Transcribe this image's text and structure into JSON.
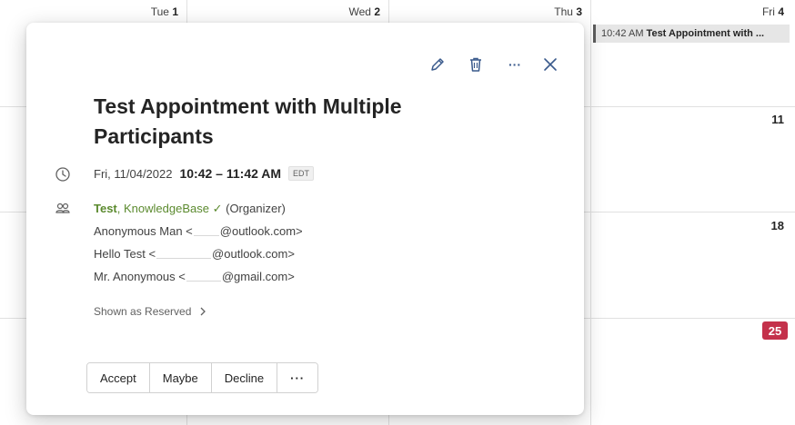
{
  "calendar": {
    "days": [
      {
        "weekday": "Tue",
        "day": "1"
      },
      {
        "weekday": "Wed",
        "day": "2"
      },
      {
        "weekday": "Thu",
        "day": "3"
      },
      {
        "weekday": "Fri",
        "day": "4"
      }
    ],
    "week_dates": [
      "11",
      "18"
    ],
    "today_date": "25",
    "event_chip": {
      "time": "10:42 AM",
      "title": "Test Appointment with ..."
    }
  },
  "popup": {
    "title": "Test Appointment with Multiple Participants",
    "date": "Fri, 11/04/2022",
    "time": "10:42 – 11:42 AM",
    "timezone": "EDT",
    "organizer": {
      "first": "Test",
      "rest": ", KnowledgeBase",
      "check": "✓",
      "role": "(Organizer)"
    },
    "participants": [
      {
        "name": "Anonymous Man <",
        "domain": "@outlook.com>"
      },
      {
        "name": "Hello Test <",
        "domain": "@outlook.com>"
      },
      {
        "name": "Mr. Anonymous <",
        "domain": "@gmail.com>"
      }
    ],
    "shown_as": "Shown as Reserved",
    "actions": {
      "accept": "Accept",
      "maybe": "Maybe",
      "decline": "Decline",
      "more": "···"
    },
    "toolbar": {
      "more": "···"
    }
  }
}
